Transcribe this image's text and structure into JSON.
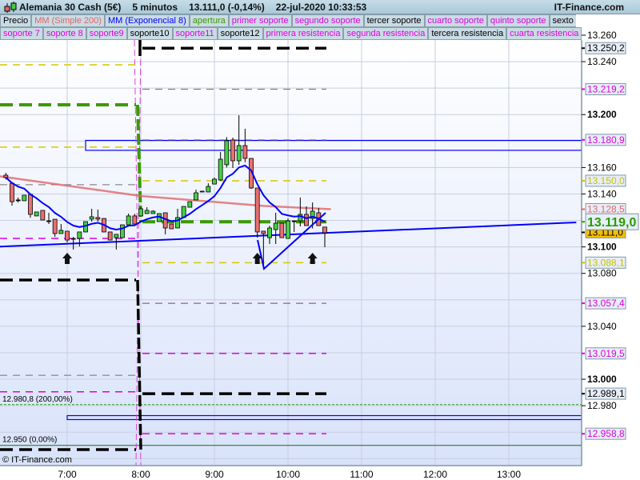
{
  "header": {
    "instrument": "Alemania 30 Cash (5€)",
    "timeframe": "5 minutos",
    "price": "13.111,0 (-0,14%)",
    "datetime": "22-jul-2020 10:33:53",
    "brand": "IT-Finance.com"
  },
  "legend_row1": [
    {
      "label": "Precio",
      "color": "#000000"
    },
    {
      "label": "MM (Simple 200)",
      "color": "#e06666"
    },
    {
      "label": "MM (Exponencial 8)",
      "color": "#0000ff"
    },
    {
      "label": "apertura",
      "color": "#3a9a00"
    },
    {
      "label": "primer soporte",
      "color": "#e000e0"
    },
    {
      "label": "segundo soporte",
      "color": "#e000e0"
    },
    {
      "label": "tercer soporte",
      "color": "#000000"
    },
    {
      "label": "cuarto soporte",
      "color": "#e000e0"
    },
    {
      "label": "quinto soporte",
      "color": "#e000e0"
    },
    {
      "label": "sexto soporte",
      "color": "#000000"
    }
  ],
  "legend_row2": [
    {
      "label": "soporte 7",
      "color": "#e000e0"
    },
    {
      "label": "soporte 8",
      "color": "#e000e0"
    },
    {
      "label": "soporte9",
      "color": "#e000e0"
    },
    {
      "label": "soporte10",
      "color": "#000000"
    },
    {
      "label": "soporte11",
      "color": "#e000e0"
    },
    {
      "label": "soporte12",
      "color": "#000000"
    },
    {
      "label": "primera resistencia",
      "color": "#e000e0"
    },
    {
      "label": "segunda resistencia",
      "color": "#e000e0"
    },
    {
      "label": "tercera resistencia",
      "color": "#000000"
    },
    {
      "label": "cuarta resistencia",
      "color": "#e000e0"
    },
    {
      "label": "quinta resistencia",
      "color": "#e000e0"
    }
  ],
  "chart_data": {
    "type": "candlestick",
    "ylim": [
      12930,
      13265
    ],
    "y_ticks": [
      {
        "v": 13260,
        "t": "13.260"
      },
      {
        "v": 13240,
        "t": "13.240"
      },
      {
        "v": 13200,
        "t": "13.200",
        "bold": true
      },
      {
        "v": 13160,
        "t": "13.160"
      },
      {
        "v": 13140,
        "t": "13.140"
      },
      {
        "v": 13100,
        "t": "13.100",
        "bold": true
      },
      {
        "v": 13080,
        "t": "13.080"
      },
      {
        "v": 13040,
        "t": "13.040"
      },
      {
        "v": 13000,
        "t": "13.000",
        "bold": true
      },
      {
        "v": 12980,
        "t": "12.980"
      }
    ],
    "x_ticks": [
      "7:00",
      "8:00",
      "9:00",
      "10:00",
      "11:00",
      "12:00",
      "13:00"
    ],
    "first_candle": "6:10",
    "interval_minutes": 5,
    "candles_ohlc": [
      [
        13154.2,
        13156,
        13151,
        13152.4
      ],
      [
        13148.1,
        13148.1,
        13131.2,
        13134.2
      ],
      [
        13135.5,
        13137.3,
        13133.6,
        13135.5
      ],
      [
        13134.9,
        13139.1,
        13134.9,
        13139.1
      ],
      [
        13139.7,
        13139.7,
        13122,
        13124.6
      ],
      [
        13123.4,
        13126.4,
        13123.4,
        13126.4
      ],
      [
        13127.6,
        13127.6,
        13120.3,
        13120.3
      ],
      [
        13119.7,
        13125.8,
        13117.3,
        13119.7
      ],
      [
        13120.9,
        13120.9,
        13107.6,
        13110.1
      ],
      [
        13110.1,
        13117.3,
        13110.1,
        13112.5
      ],
      [
        13111.9,
        13111.9,
        13103.4,
        13105.2
      ],
      [
        13106.4,
        13107.6,
        13098,
        13106.4
      ],
      [
        13106.4,
        13111.3,
        13100.4,
        13111.3
      ],
      [
        13111.3,
        13119.1,
        13111.3,
        13119.1
      ],
      [
        13121,
        13128.8,
        13119.1,
        13122.8
      ],
      [
        13122.2,
        13128.2,
        13119.1,
        13121
      ],
      [
        13121.5,
        13121.5,
        13111.3,
        13111.3
      ],
      [
        13111.3,
        13111.3,
        13105.2,
        13105.2
      ],
      [
        13107,
        13109.5,
        13098,
        13109.5
      ],
      [
        13107,
        13116.7,
        13107,
        13116.7
      ],
      [
        13116.7,
        13125.2,
        13116.7,
        13123.4
      ],
      [
        13123.4,
        13125,
        13117.3,
        13117.3
      ],
      [
        13123.4,
        13130,
        13123.4,
        13128.8
      ],
      [
        13125.2,
        13130,
        13125,
        13127.6
      ],
      [
        13125.2,
        13127.6,
        13125.2,
        13127
      ],
      [
        13119.1,
        13125.2,
        13119.1,
        13125.2
      ],
      [
        13125.8,
        13125.8,
        13109.5,
        13114.3
      ],
      [
        13117.3,
        13117.3,
        13113.7,
        13113.7
      ],
      [
        13114.3,
        13128.8,
        13114.3,
        13122.2
      ],
      [
        13122.2,
        13130.6,
        13122.2,
        13130.6
      ],
      [
        13130,
        13134.2,
        13130,
        13134.2
      ],
      [
        13135.5,
        13143.3,
        13135.5,
        13140.9
      ],
      [
        13141.5,
        13142.5,
        13141.5,
        13142.1
      ],
      [
        13141.5,
        13148.1,
        13141.5,
        13145.7
      ],
      [
        13147.5,
        13152.4,
        13147.5,
        13151.2
      ],
      [
        13150.6,
        13171.7,
        13150,
        13166.3
      ],
      [
        13162.1,
        13183,
        13160,
        13180.2
      ],
      [
        13180.8,
        13182.6,
        13159.6,
        13165.1
      ],
      [
        13165.1,
        13199.5,
        13162,
        13176.6
      ],
      [
        13176.6,
        13189.3,
        13164,
        13166.9
      ],
      [
        13166.9,
        13166.9,
        13143.9,
        13144.5
      ],
      [
        13144.5,
        13144.5,
        13107,
        13111.3
      ],
      [
        13111.9,
        13112,
        13084.7,
        13110.1
      ],
      [
        13107,
        13116,
        13102.2,
        13114.3
      ],
      [
        13113.1,
        13125.8,
        13102.2,
        13117.9
      ],
      [
        13117.9,
        13117.9,
        13107,
        13107
      ],
      [
        13106.4,
        13121.5,
        13106.4,
        13119.7
      ],
      [
        13119.7,
        13120,
        13111.3,
        13119.7
      ],
      [
        13119.7,
        13137.3,
        13115.5,
        13124.6
      ],
      [
        13124.6,
        13130.6,
        13116.1,
        13116.1
      ],
      [
        13121.5,
        13133.6,
        13114,
        13127
      ],
      [
        13125.8,
        13129.4,
        13116.1,
        13116.1
      ],
      [
        13115,
        13115,
        13099.8,
        13110.7
      ]
    ],
    "sma200": [
      [
        "6:00",
        13154
      ],
      [
        "8:00",
        13138.5
      ],
      [
        "9:40",
        13131
      ],
      [
        "10:35",
        13128.5
      ]
    ],
    "levels_previous_day": [
      {
        "v": 13237.6,
        "color": "#d4c800",
        "w": 1.5
      },
      {
        "v": 13207.4,
        "color": "#3a9a00",
        "w": 4
      },
      {
        "v": 13175.4,
        "color": "#d4c800",
        "w": 1.5
      },
      {
        "v": 13147,
        "color": "#707070",
        "w": 1
      },
      {
        "v": 13106.4,
        "color": "#e000e0",
        "w": 1.5
      },
      {
        "v": 13075,
        "color": "#000000",
        "w": 3.5
      },
      {
        "v": 13003,
        "color": "#707070",
        "w": 1
      },
      {
        "v": 12990.5,
        "color": "#e000e0",
        "w": 1.5
      },
      {
        "v": 12946.8,
        "color": "#000000",
        "w": 3.5
      }
    ],
    "levels_today": [
      {
        "v": 13250.2,
        "color": "#000000",
        "w": 3.5,
        "label": "13.250,2",
        "lc": "#000000"
      },
      {
        "v": 13219.2,
        "color": "#707070",
        "w": 1,
        "label": "13.219,2",
        "lc": "#e000e0"
      },
      {
        "v": 13180.9,
        "color": "#707070",
        "w": 1,
        "label": "13.180,9",
        "lc": "#e000e0"
      },
      {
        "v": 13150.0,
        "color": "#d4c800",
        "w": 1.5,
        "label": "13.150,0",
        "lc": "#c8c000"
      },
      {
        "v": 13119.0,
        "color": "#3a9a00",
        "w": 4
      },
      {
        "v": 13088.1,
        "color": "#d4c800",
        "w": 1.5,
        "label": "13.088,1",
        "lc": "#c8c000"
      },
      {
        "v": 13057.4,
        "color": "#804080",
        "w": 1,
        "label": "13.057,4",
        "lc": "#e000e0"
      },
      {
        "v": 13019.5,
        "color": "#e000e0",
        "w": 1.5,
        "label": "13.019,5",
        "lc": "#e000e0"
      },
      {
        "v": 12989.1,
        "color": "#000000",
        "w": 3.5,
        "label": "12.989,1",
        "lc": "#000000"
      },
      {
        "v": 12958.8,
        "color": "#e000e0",
        "w": 1.5,
        "label": "12.958,8",
        "lc": "#e000e0"
      }
    ],
    "sma_label": "13.128,5",
    "current_open_label": "13.119,0",
    "last_price_label": "13.111,0",
    "fib_high": {
      "v": 12980.8,
      "label": "12.980,8 (200,00%)"
    },
    "fib_low": {
      "v": 12950,
      "label": "12.950 (0,00%)"
    },
    "zones": [
      {
        "from": "7:15",
        "top": 13180.5,
        "bottom": 13173
      },
      {
        "from": "7:00",
        "top": 12972.5,
        "bottom": 12969.5
      }
    ],
    "trendline": [
      [
        "6:00",
        13100
      ],
      [
        "13:55",
        13118.5
      ]
    ],
    "arrows_up": [
      "7:00",
      "9:35",
      "10:20"
    ],
    "watermark": "© IT-Finance.com"
  }
}
